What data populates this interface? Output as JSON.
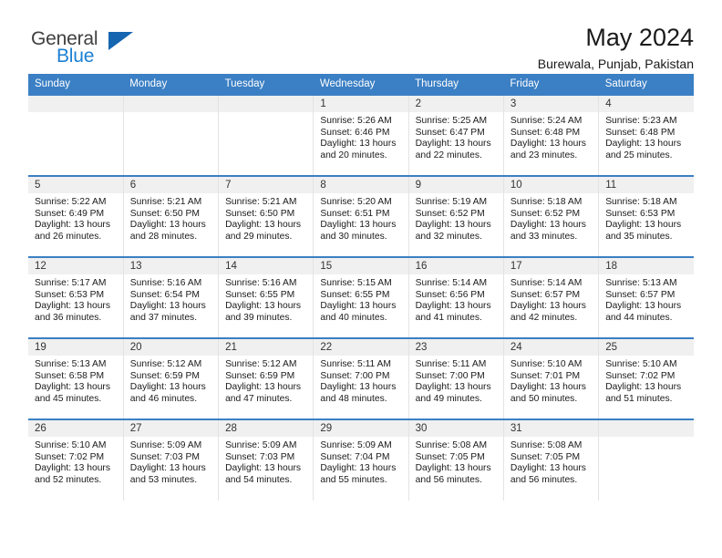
{
  "brand": {
    "word_one": "General",
    "word_two": "Blue",
    "triangle_icon": "triangle-icon",
    "accent_color": "#1565b0"
  },
  "header": {
    "title": "May 2024",
    "location": "Burewala, Punjab, Pakistan",
    "header_bg": "#3b7fc4",
    "daynum_bg": "#f0f0f0"
  },
  "weekdays": [
    "Sunday",
    "Monday",
    "Tuesday",
    "Wednesday",
    "Thursday",
    "Friday",
    "Saturday"
  ],
  "labels": {
    "sunrise": "Sunrise:",
    "sunset": "Sunset:",
    "daylight": "Daylight:"
  },
  "weeks": [
    [
      {
        "empty": true
      },
      {
        "empty": true
      },
      {
        "empty": true
      },
      {
        "day": "1",
        "sunrise": "Sunrise: 5:26 AM",
        "sunset": "Sunset: 6:46 PM",
        "daylight": "Daylight: 13 hours and 20 minutes."
      },
      {
        "day": "2",
        "sunrise": "Sunrise: 5:25 AM",
        "sunset": "Sunset: 6:47 PM",
        "daylight": "Daylight: 13 hours and 22 minutes."
      },
      {
        "day": "3",
        "sunrise": "Sunrise: 5:24 AM",
        "sunset": "Sunset: 6:48 PM",
        "daylight": "Daylight: 13 hours and 23 minutes."
      },
      {
        "day": "4",
        "sunrise": "Sunrise: 5:23 AM",
        "sunset": "Sunset: 6:48 PM",
        "daylight": "Daylight: 13 hours and 25 minutes."
      }
    ],
    [
      {
        "day": "5",
        "sunrise": "Sunrise: 5:22 AM",
        "sunset": "Sunset: 6:49 PM",
        "daylight": "Daylight: 13 hours and 26 minutes."
      },
      {
        "day": "6",
        "sunrise": "Sunrise: 5:21 AM",
        "sunset": "Sunset: 6:50 PM",
        "daylight": "Daylight: 13 hours and 28 minutes."
      },
      {
        "day": "7",
        "sunrise": "Sunrise: 5:21 AM",
        "sunset": "Sunset: 6:50 PM",
        "daylight": "Daylight: 13 hours and 29 minutes."
      },
      {
        "day": "8",
        "sunrise": "Sunrise: 5:20 AM",
        "sunset": "Sunset: 6:51 PM",
        "daylight": "Daylight: 13 hours and 30 minutes."
      },
      {
        "day": "9",
        "sunrise": "Sunrise: 5:19 AM",
        "sunset": "Sunset: 6:52 PM",
        "daylight": "Daylight: 13 hours and 32 minutes."
      },
      {
        "day": "10",
        "sunrise": "Sunrise: 5:18 AM",
        "sunset": "Sunset: 6:52 PM",
        "daylight": "Daylight: 13 hours and 33 minutes."
      },
      {
        "day": "11",
        "sunrise": "Sunrise: 5:18 AM",
        "sunset": "Sunset: 6:53 PM",
        "daylight": "Daylight: 13 hours and 35 minutes."
      }
    ],
    [
      {
        "day": "12",
        "sunrise": "Sunrise: 5:17 AM",
        "sunset": "Sunset: 6:53 PM",
        "daylight": "Daylight: 13 hours and 36 minutes."
      },
      {
        "day": "13",
        "sunrise": "Sunrise: 5:16 AM",
        "sunset": "Sunset: 6:54 PM",
        "daylight": "Daylight: 13 hours and 37 minutes."
      },
      {
        "day": "14",
        "sunrise": "Sunrise: 5:16 AM",
        "sunset": "Sunset: 6:55 PM",
        "daylight": "Daylight: 13 hours and 39 minutes."
      },
      {
        "day": "15",
        "sunrise": "Sunrise: 5:15 AM",
        "sunset": "Sunset: 6:55 PM",
        "daylight": "Daylight: 13 hours and 40 minutes."
      },
      {
        "day": "16",
        "sunrise": "Sunrise: 5:14 AM",
        "sunset": "Sunset: 6:56 PM",
        "daylight": "Daylight: 13 hours and 41 minutes."
      },
      {
        "day": "17",
        "sunrise": "Sunrise: 5:14 AM",
        "sunset": "Sunset: 6:57 PM",
        "daylight": "Daylight: 13 hours and 42 minutes."
      },
      {
        "day": "18",
        "sunrise": "Sunrise: 5:13 AM",
        "sunset": "Sunset: 6:57 PM",
        "daylight": "Daylight: 13 hours and 44 minutes."
      }
    ],
    [
      {
        "day": "19",
        "sunrise": "Sunrise: 5:13 AM",
        "sunset": "Sunset: 6:58 PM",
        "daylight": "Daylight: 13 hours and 45 minutes."
      },
      {
        "day": "20",
        "sunrise": "Sunrise: 5:12 AM",
        "sunset": "Sunset: 6:59 PM",
        "daylight": "Daylight: 13 hours and 46 minutes."
      },
      {
        "day": "21",
        "sunrise": "Sunrise: 5:12 AM",
        "sunset": "Sunset: 6:59 PM",
        "daylight": "Daylight: 13 hours and 47 minutes."
      },
      {
        "day": "22",
        "sunrise": "Sunrise: 5:11 AM",
        "sunset": "Sunset: 7:00 PM",
        "daylight": "Daylight: 13 hours and 48 minutes."
      },
      {
        "day": "23",
        "sunrise": "Sunrise: 5:11 AM",
        "sunset": "Sunset: 7:00 PM",
        "daylight": "Daylight: 13 hours and 49 minutes."
      },
      {
        "day": "24",
        "sunrise": "Sunrise: 5:10 AM",
        "sunset": "Sunset: 7:01 PM",
        "daylight": "Daylight: 13 hours and 50 minutes."
      },
      {
        "day": "25",
        "sunrise": "Sunrise: 5:10 AM",
        "sunset": "Sunset: 7:02 PM",
        "daylight": "Daylight: 13 hours and 51 minutes."
      }
    ],
    [
      {
        "day": "26",
        "sunrise": "Sunrise: 5:10 AM",
        "sunset": "Sunset: 7:02 PM",
        "daylight": "Daylight: 13 hours and 52 minutes."
      },
      {
        "day": "27",
        "sunrise": "Sunrise: 5:09 AM",
        "sunset": "Sunset: 7:03 PM",
        "daylight": "Daylight: 13 hours and 53 minutes."
      },
      {
        "day": "28",
        "sunrise": "Sunrise: 5:09 AM",
        "sunset": "Sunset: 7:03 PM",
        "daylight": "Daylight: 13 hours and 54 minutes."
      },
      {
        "day": "29",
        "sunrise": "Sunrise: 5:09 AM",
        "sunset": "Sunset: 7:04 PM",
        "daylight": "Daylight: 13 hours and 55 minutes."
      },
      {
        "day": "30",
        "sunrise": "Sunrise: 5:08 AM",
        "sunset": "Sunset: 7:05 PM",
        "daylight": "Daylight: 13 hours and 56 minutes."
      },
      {
        "day": "31",
        "sunrise": "Sunrise: 5:08 AM",
        "sunset": "Sunset: 7:05 PM",
        "daylight": "Daylight: 13 hours and 56 minutes."
      },
      {
        "empty": true
      }
    ]
  ]
}
